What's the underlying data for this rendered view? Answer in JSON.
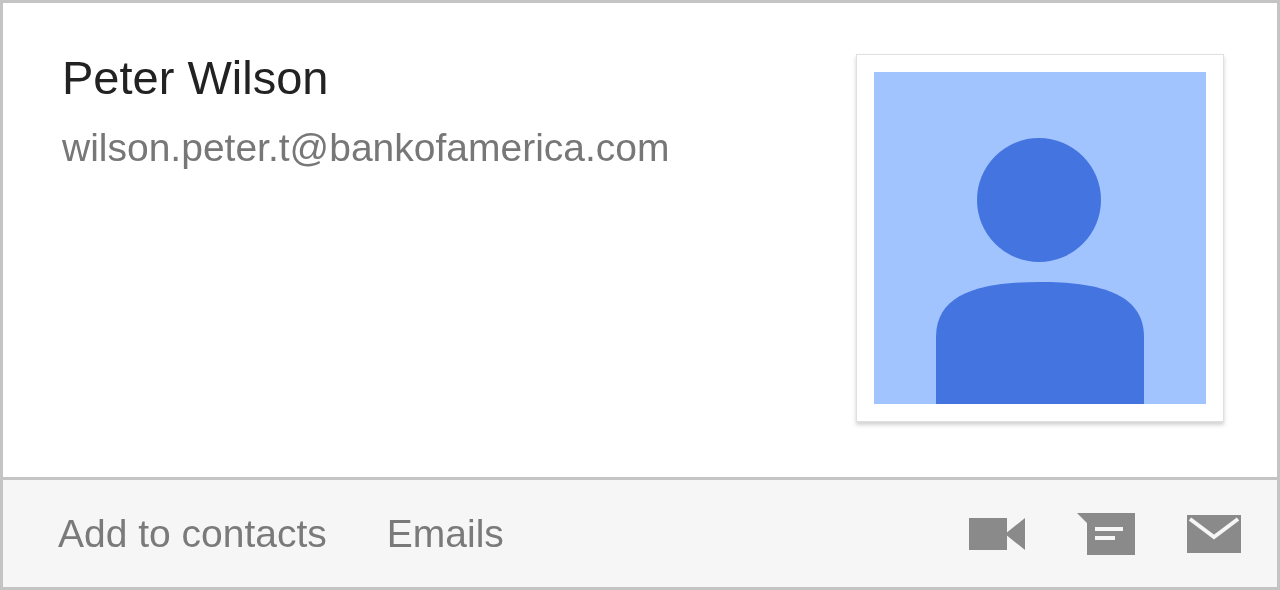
{
  "contact": {
    "name": "Peter Wilson",
    "email": "wilson.peter.t@bankofamerica.com"
  },
  "actions": [
    {
      "label": "Add to contacts"
    },
    {
      "label": "Emails"
    }
  ]
}
